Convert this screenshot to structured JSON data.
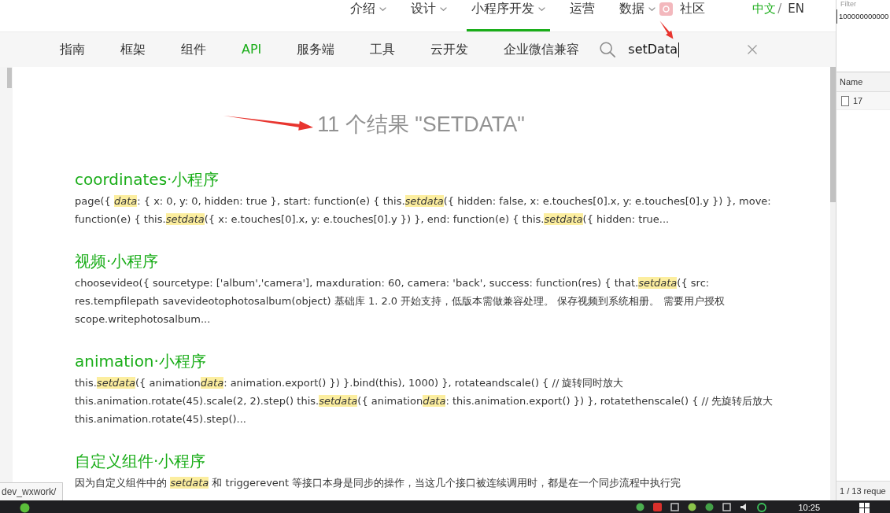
{
  "top_nav": {
    "items": [
      {
        "label": "介绍",
        "dropdown": true,
        "selected": false
      },
      {
        "label": "设计",
        "dropdown": true,
        "selected": false
      },
      {
        "label": "小程序开发",
        "dropdown": true,
        "selected": true
      },
      {
        "label": "运营",
        "dropdown": false,
        "selected": false
      },
      {
        "label": "数据",
        "dropdown": true,
        "selected": false
      },
      {
        "label": "社区",
        "dropdown": false,
        "selected": false
      }
    ],
    "languages": [
      {
        "label": "中文",
        "selected": true
      },
      {
        "label": "EN",
        "selected": false
      }
    ],
    "language_separator": "/"
  },
  "sub_nav": {
    "items": [
      {
        "label": "指南",
        "selected": false
      },
      {
        "label": "框架",
        "selected": false
      },
      {
        "label": "组件",
        "selected": false
      },
      {
        "label": "API",
        "selected": true
      },
      {
        "label": "服务端",
        "selected": false
      },
      {
        "label": "工具",
        "selected": false
      },
      {
        "label": "云开发",
        "selected": false
      },
      {
        "label": "企业微信兼容",
        "selected": false
      }
    ],
    "search": {
      "value": "setData"
    }
  },
  "results": {
    "heading": "11 个结果 \"SETDATA\"",
    "items": [
      {
        "title": "coordinates·小程序",
        "snippet": [
          {
            "text": "page({ ",
            "highlight": false
          },
          {
            "text": "data",
            "highlight": true
          },
          {
            "text": ": { x: 0, y: 0, hidden: true }, start: function(e) { this.",
            "highlight": false
          },
          {
            "text": "setdata",
            "highlight": true
          },
          {
            "text": "({ hidden: false, x: e.touches[0].x, y: e.touches[0].y }) }, move: function(e) { this.",
            "highlight": false
          },
          {
            "text": "setdata",
            "highlight": true
          },
          {
            "text": "({ x: e.touches[0].x, y: e.touches[0].y }) }, end: function(e) { this.",
            "highlight": false
          },
          {
            "text": "setdata",
            "highlight": true
          },
          {
            "text": "({ hidden: true...",
            "highlight": false
          }
        ]
      },
      {
        "title": "视频·小程序",
        "snippet": [
          {
            "text": "choosevideo({ sourcetype: ['album','camera'], maxduration: 60, camera: 'back', success: function(res) { that.",
            "highlight": false
          },
          {
            "text": "setdata",
            "highlight": true
          },
          {
            "text": "({ src: res.tempfilepath savevideotophotosalbum(object) 基础库 1. 2.0 开始支持，低版本需做兼容处理。 保存视频到系统相册。 需要用户授权 scope.writephotosalbum...",
            "highlight": false
          }
        ]
      },
      {
        "title": "animation·小程序",
        "snippet": [
          {
            "text": "this.",
            "highlight": false
          },
          {
            "text": "setdata",
            "highlight": true
          },
          {
            "text": "({ animation",
            "highlight": false
          },
          {
            "text": "data",
            "highlight": true
          },
          {
            "text": ": animation.export() }) }.bind(this), 1000) }, rotateandscale() { // 旋转同时放大 this.animation.rotate(45).scale(2, 2).step() this.",
            "highlight": false
          },
          {
            "text": "setdata",
            "highlight": true
          },
          {
            "text": "({ animation",
            "highlight": false
          },
          {
            "text": "data",
            "highlight": true
          },
          {
            "text": ": this.animation.export() }) }, rotatethenscale() { // 先旋转后放大 this.animation.rotate(45).step()...",
            "highlight": false
          }
        ]
      },
      {
        "title": "自定义组件·小程序",
        "snippet": [
          {
            "text": "因为自定义组件中的 ",
            "highlight": false
          },
          {
            "text": "setdata",
            "highlight": true
          },
          {
            "text": " 和 triggerevent 等接口本身是同步的操作，当这几个接口被连续调用时，都是在一个同步流程中执行完",
            "highlight": false
          }
        ]
      }
    ]
  },
  "devtools": {
    "filter_label": "Filter",
    "filter_value": "100000000000",
    "column": "Name",
    "rows": [
      {
        "name": "17"
      }
    ],
    "status": "1 / 13 reque"
  },
  "status_url": "dev_wxwork/",
  "taskbar": {
    "time": "10:25"
  }
}
